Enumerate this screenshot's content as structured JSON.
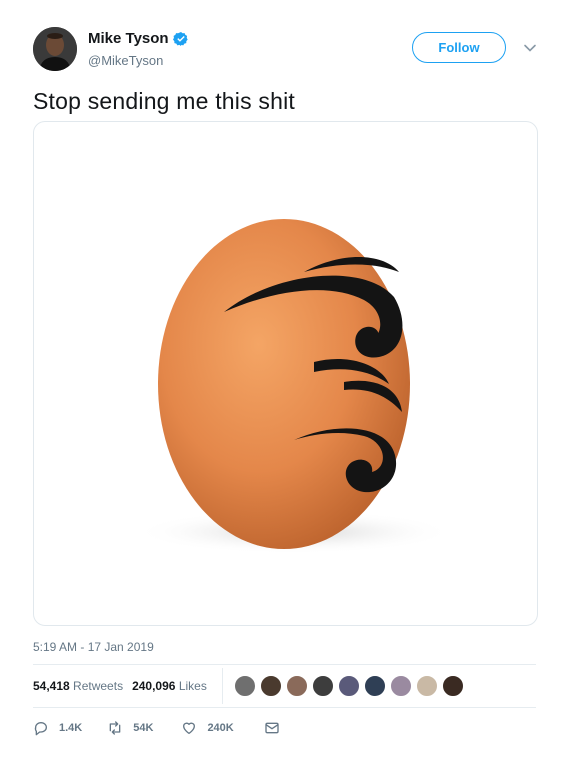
{
  "user": {
    "display_name": "Mike Tyson",
    "handle": "@MikeTyson",
    "verified": true
  },
  "header": {
    "follow_label": "Follow"
  },
  "tweet": {
    "text": "Stop sending me this shit",
    "timestamp": "5:19 AM - 17 Jan 2019",
    "media_description": "egg-with-tribal-tattoo"
  },
  "stats": {
    "retweets_count": "54,418",
    "retweets_label": "Retweets",
    "likes_count": "240,096",
    "likes_label": "Likes"
  },
  "likers": [
    {
      "icon": "liker-avatar"
    },
    {
      "icon": "liker-avatar"
    },
    {
      "icon": "liker-avatar"
    },
    {
      "icon": "liker-avatar"
    },
    {
      "icon": "liker-avatar"
    },
    {
      "icon": "liker-avatar"
    },
    {
      "icon": "liker-avatar"
    },
    {
      "icon": "liker-avatar"
    },
    {
      "icon": "liker-avatar"
    },
    {
      "icon": "liker-avatar"
    }
  ],
  "actions": {
    "reply_count": "1.4K",
    "retweet_count": "54K",
    "like_count": "240K"
  },
  "colors": {
    "accent": "#1da1f2",
    "secondary_text": "#657786",
    "divider": "#e6ecf0"
  }
}
